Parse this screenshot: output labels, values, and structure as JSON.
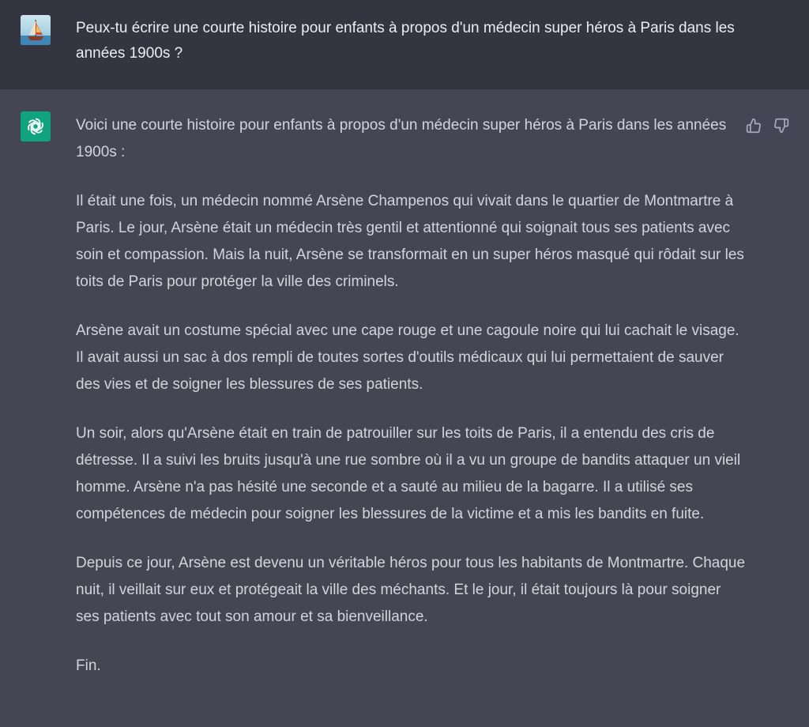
{
  "conversation": {
    "user_message": "Peux-tu écrire une courte histoire pour enfants à propos d'un médecin super héros à Paris dans les années 1900s ?",
    "assistant_paragraphs": [
      "Voici une courte histoire pour enfants à propos d'un médecin super héros à Paris dans les années 1900s :",
      "Il était une fois, un médecin nommé Arsène Champenos qui vivait dans le quartier de Montmartre à Paris. Le jour, Arsène était un médecin très gentil et attentionné qui soignait tous ses patients avec soin et compassion. Mais la nuit, Arsène se transformait en un super héros masqué qui rôdait sur les toits de Paris pour protéger la ville des criminels.",
      "Arsène avait un costume spécial avec une cape rouge et une cagoule noire qui lui cachait le visage. Il avait aussi un sac à dos rempli de toutes sortes d'outils médicaux qui lui permettaient de sauver des vies et de soigner les blessures de ses patients.",
      "Un soir, alors qu'Arsène était en train de patrouiller sur les toits de Paris, il a entendu des cris de détresse. Il a suivi les bruits jusqu'à une rue sombre où il a vu un groupe de bandits attaquer un vieil homme. Arsène n'a pas hésité une seconde et a sauté au milieu de la bagarre. Il a utilisé ses compétences de médecin pour soigner les blessures de la victime et a mis les bandits en fuite.",
      "Depuis ce jour, Arsène est devenu un véritable héros pour tous les habitants de Montmartre. Chaque nuit, il veillait sur eux et protégeait la ville des méchants. Et le jour, il était toujours là pour soigner ses patients avec tout son amour et sa bienveillance.",
      "Fin."
    ]
  },
  "icons": {
    "user_avatar": "sailboat-avatar-icon",
    "assistant_avatar": "openai-logo-icon",
    "like": "thumbs-up-icon",
    "dislike": "thumbs-down-icon"
  },
  "colors": {
    "user_bg": "#343541",
    "assistant_bg": "#444654",
    "accent": "#10a37f",
    "text": "#d1d5db"
  }
}
